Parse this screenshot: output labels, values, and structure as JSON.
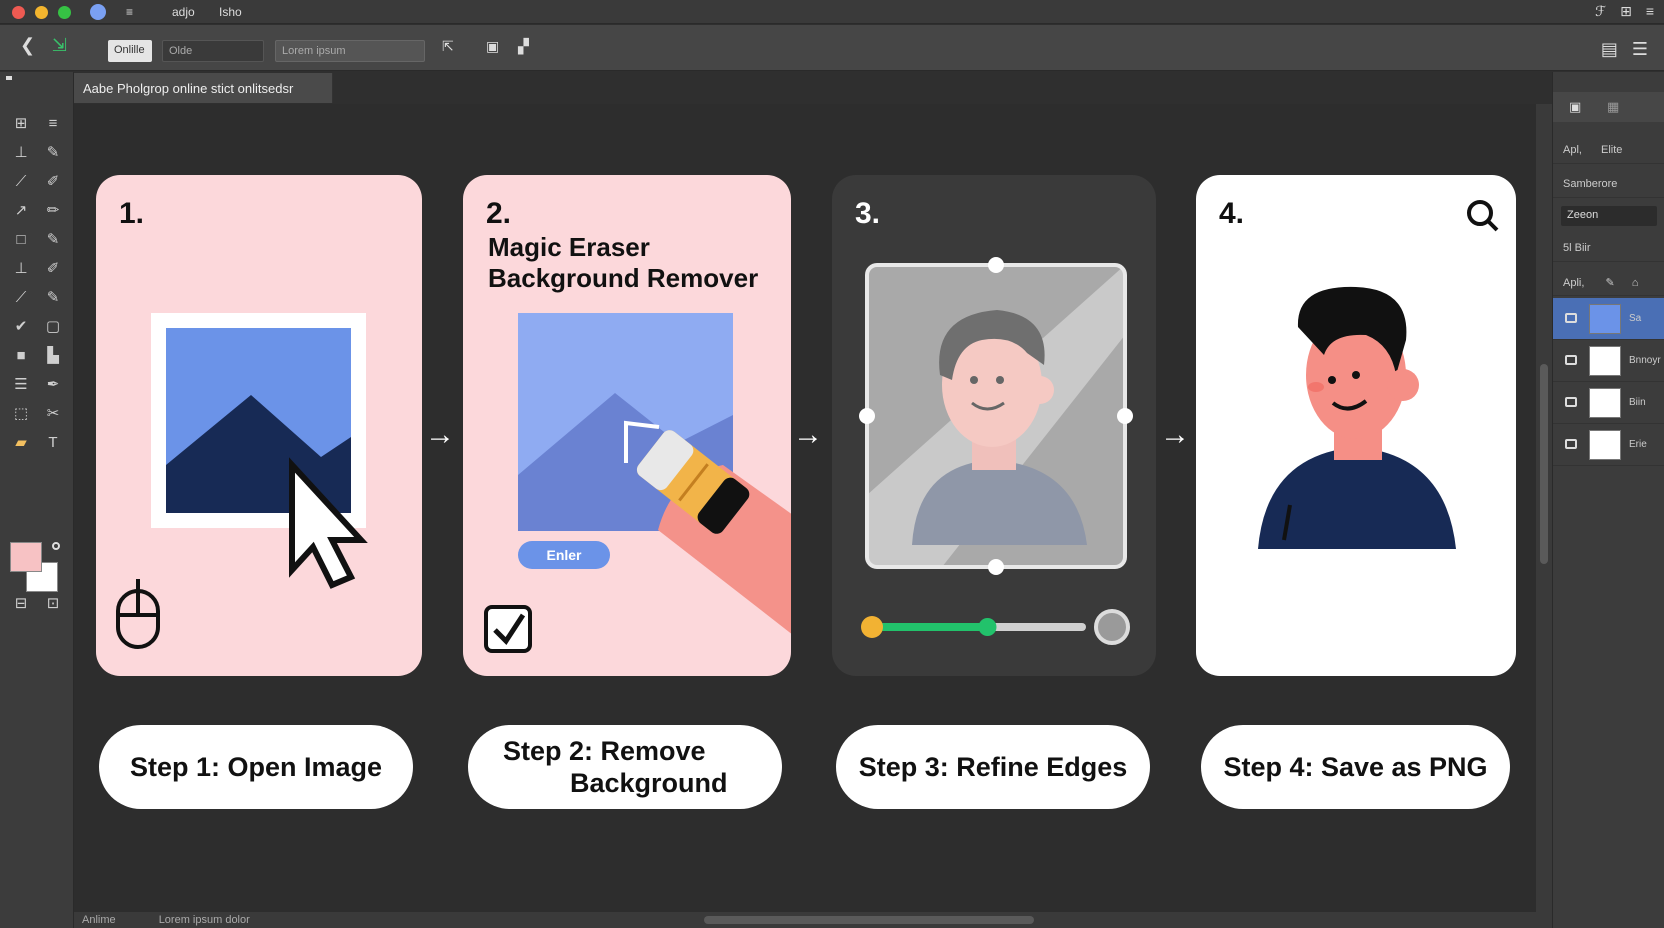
{
  "window": {
    "menu": [
      "≡",
      "adjo",
      "Isho"
    ],
    "title_icons": [
      "ℱ",
      "⊞",
      "≡"
    ]
  },
  "options_bar": {
    "field1": "Onlille",
    "field2": "Olde",
    "field3": "Lorem ipsum"
  },
  "document": {
    "tab_title": "Aabe Pholgrop online stict onlitsedsr"
  },
  "steps": [
    {
      "number": "1.",
      "pill": "Step 1: Open Image"
    },
    {
      "number": "2.",
      "title": "Magic Eraser Background Remover",
      "button": "Enler",
      "pill_line1": "Step 2: Remove",
      "pill_line2": "Background"
    },
    {
      "number": "3.",
      "pill": "Step 3: Refine Edges",
      "slider_value": 0.55
    },
    {
      "number": "4.",
      "pill": "Step 4: Save as PNG"
    }
  ],
  "right_panel": {
    "tab1": "Apl,",
    "tab2": "Elite",
    "section1": "Samberore",
    "zoom_label": "Zeeon",
    "section2": "5l Biir",
    "layers_header": "Apli,",
    "layers": [
      "Sa",
      "Bnnoyr",
      "Biin",
      "Erie"
    ]
  },
  "status": {
    "left": "Anlime",
    "text": "Lorem ipsum dolor"
  },
  "colors": {
    "pink_card": "#fcd8db",
    "blue_sky": "#6b93e8",
    "navy": "#172a55",
    "skin": "#f58f86",
    "slider_green": "#22c26b",
    "slider_start": "#f2b233"
  }
}
